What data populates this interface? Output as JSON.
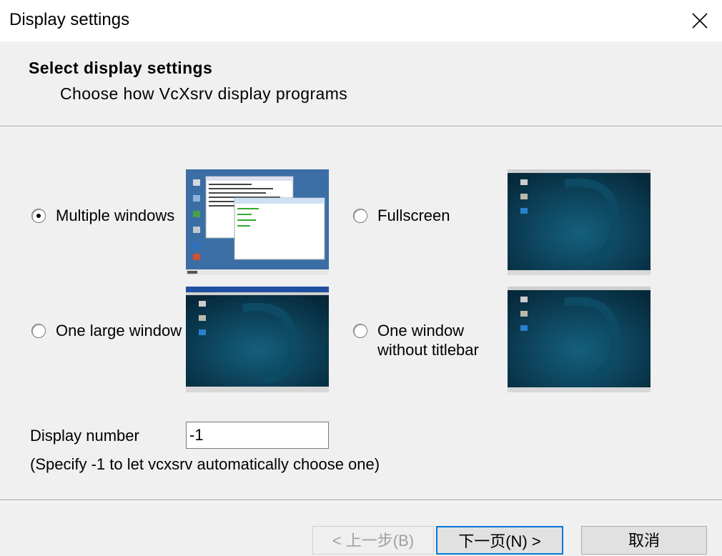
{
  "window": {
    "title": "Display settings"
  },
  "header": {
    "title": "Select display settings",
    "subtitle": "Choose how VcXsrv display programs"
  },
  "options": [
    {
      "label": "Multiple windows",
      "selected": true
    },
    {
      "label": "Fullscreen",
      "selected": false
    },
    {
      "label": "One large window",
      "selected": false
    },
    {
      "label_line1": "One window",
      "label_line2": "without titlebar",
      "selected": false
    }
  ],
  "display_number": {
    "label": "Display number",
    "value": "-1",
    "hint": "(Specify -1 to let vcxsrv automatically choose one)"
  },
  "buttons": {
    "back": "< 上一步(B)",
    "next": "下一页(N) >",
    "cancel": "取消"
  },
  "colors": {
    "accent": "#0078d7",
    "desktop_blue": "#3a6ea5",
    "debian_dark": "#0b3f55"
  }
}
